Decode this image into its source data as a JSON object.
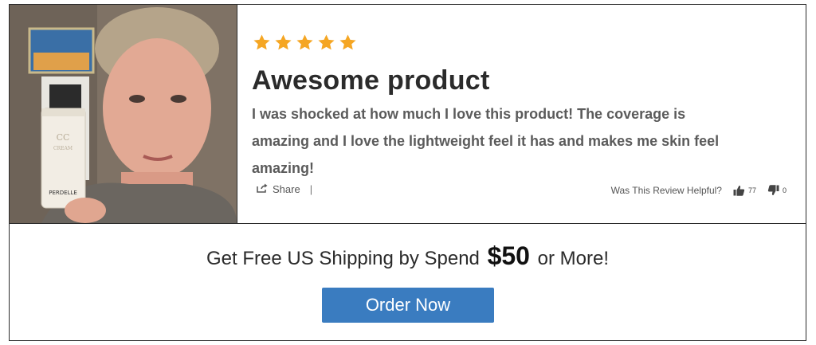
{
  "review": {
    "rating": 5,
    "rating_max": 5,
    "star_color": "#f5a623",
    "title": "Awesome product",
    "body": "I was shocked at how much I love this product! The coverage is amazing and I love the lightweight feel it has and makes me skin feel amazing!",
    "share_label": "Share",
    "separator": "|",
    "helpful_question": "Was This Review Helpful?",
    "upvotes": "77",
    "downvotes": "0",
    "photo_icon": "reviewer-photo",
    "product_brand": "PERDELLE",
    "product_name": "CC CREAM"
  },
  "promo": {
    "prefix": "Get Free US Shipping by Spend",
    "amount": "$50",
    "suffix": "or More!"
  },
  "cta": {
    "label": "Order Now",
    "color": "#3a7cc0"
  }
}
